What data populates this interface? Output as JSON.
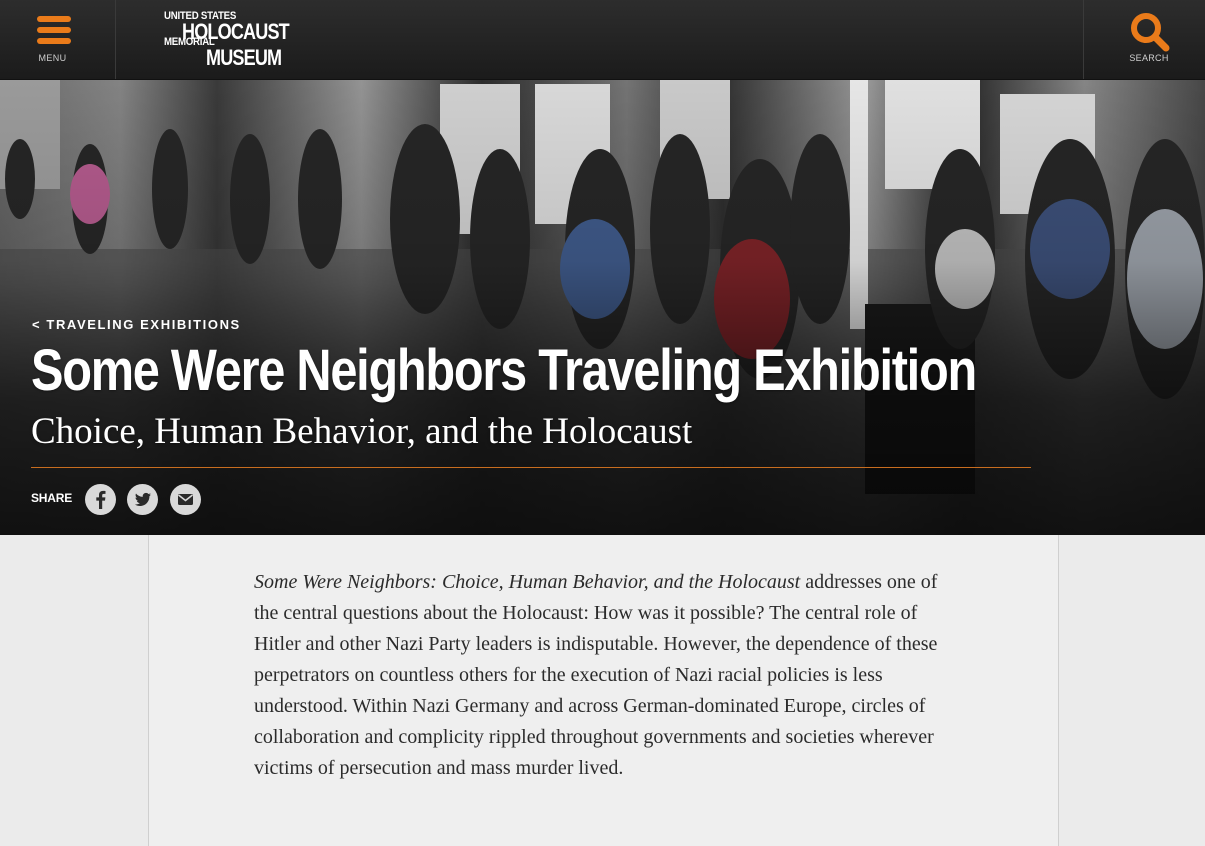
{
  "header": {
    "menu_label": "MENU",
    "search_label": "SEARCH",
    "logo": {
      "line1": "UNITED STATES",
      "line2": "HOLOCAUST",
      "line3": "MEMORIAL",
      "line4": "MUSEUM"
    }
  },
  "hero": {
    "breadcrumb": "< TRAVELING EXHIBITIONS",
    "title": "Some Were Neighbors Traveling Exhibition",
    "subtitle": "Choice, Human Behavior, and the Holocaust",
    "share_label": "SHARE",
    "share_icons": [
      "facebook-icon",
      "twitter-icon",
      "email-icon"
    ]
  },
  "content": {
    "intro_title": "Some Were Neighbors: Choice, Human Behavior, and the Holocaust",
    "intro_text": " addresses one of the central questions about the Holocaust: How was it possible? The central role of Hitler and other Nazi Party leaders is indisputable. However, the dependence of these perpetrators on countless others for the execution of Nazi racial policies is less understood. Within Nazi Germany and across German-dominated Europe, circles of collaboration and complicity rippled throughout governments and societies wherever victims of persecution and mass murder lived."
  },
  "colors": {
    "accent": "#ea7b1a",
    "header_bg": "#222222",
    "page_bg": "#ebebeb",
    "body_text": "#2b2b2b"
  }
}
